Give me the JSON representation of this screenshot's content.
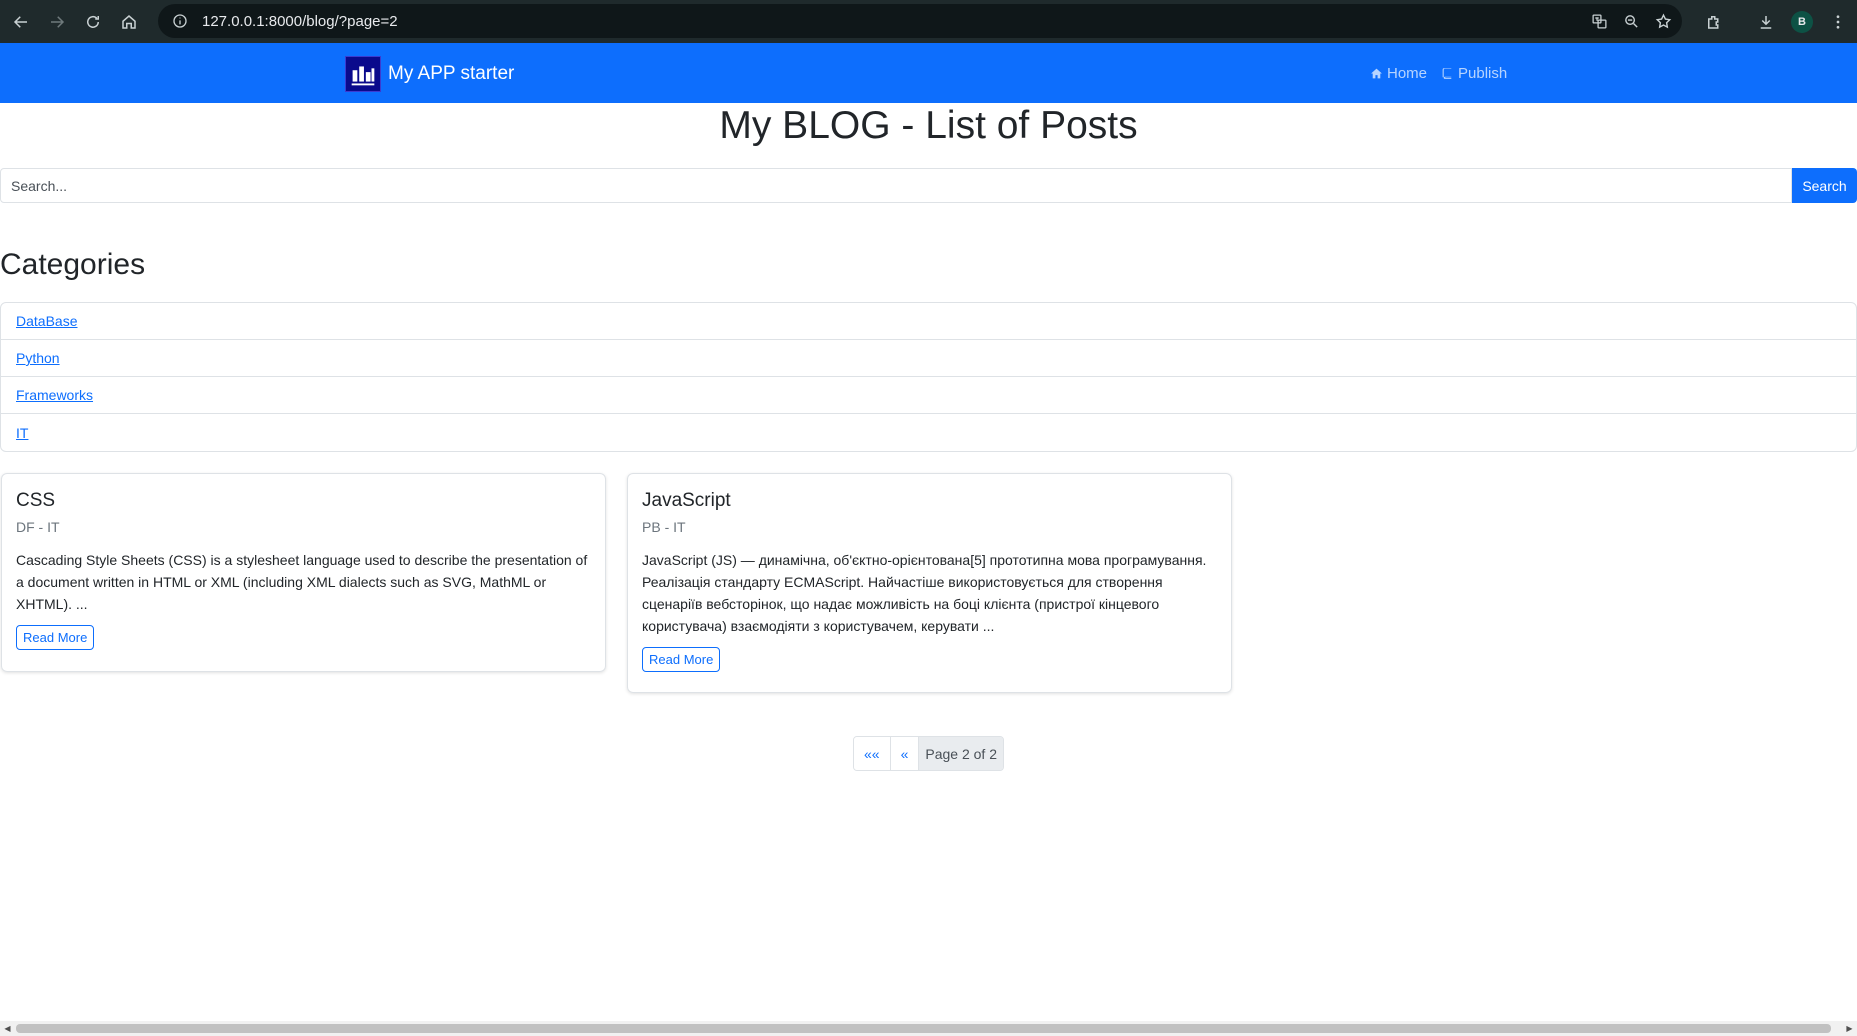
{
  "browser": {
    "url": "127.0.0.1:8000/blog/?page=2",
    "profile_initial": "B"
  },
  "navbar": {
    "brand": "My APP starter",
    "links": [
      {
        "label": "Home",
        "icon": "home-icon"
      },
      {
        "label": "Publish",
        "icon": "book-icon"
      }
    ],
    "color": "#0d6efd"
  },
  "main": {
    "title": "My BLOG - List of Posts",
    "search": {
      "placeholder": "Search...",
      "button": "Search"
    },
    "categories_heading": "Categories",
    "categories": [
      "DataBase",
      "Python",
      "Frameworks",
      "IT"
    ],
    "posts": [
      {
        "title": "CSS",
        "meta": "DF - IT",
        "excerpt": "Cascading Style Sheets (CSS) is a stylesheet language used to describe the presentation of a document written in HTML or XML (including XML dialects such as SVG, MathML or XHTML). ...",
        "read_more": "Read More"
      },
      {
        "title": "JavaScript",
        "meta": "PB - IT",
        "excerpt": "JavaScript (JS) — динамічна, об'єктно-орієнтована[5] прототипна мова програмування. Реалізація стандарту ECMAScript. Найчастіше використовується для створення сценаріїв вебсторінок, що надає можливість на боці клієнта (пристрої кінцевого користувача) взаємодіяти з користувачем, керувати ...",
        "read_more": "Read More"
      }
    ],
    "pagination": {
      "first": "««",
      "prev": "«",
      "current": "Page 2 of 2"
    }
  }
}
